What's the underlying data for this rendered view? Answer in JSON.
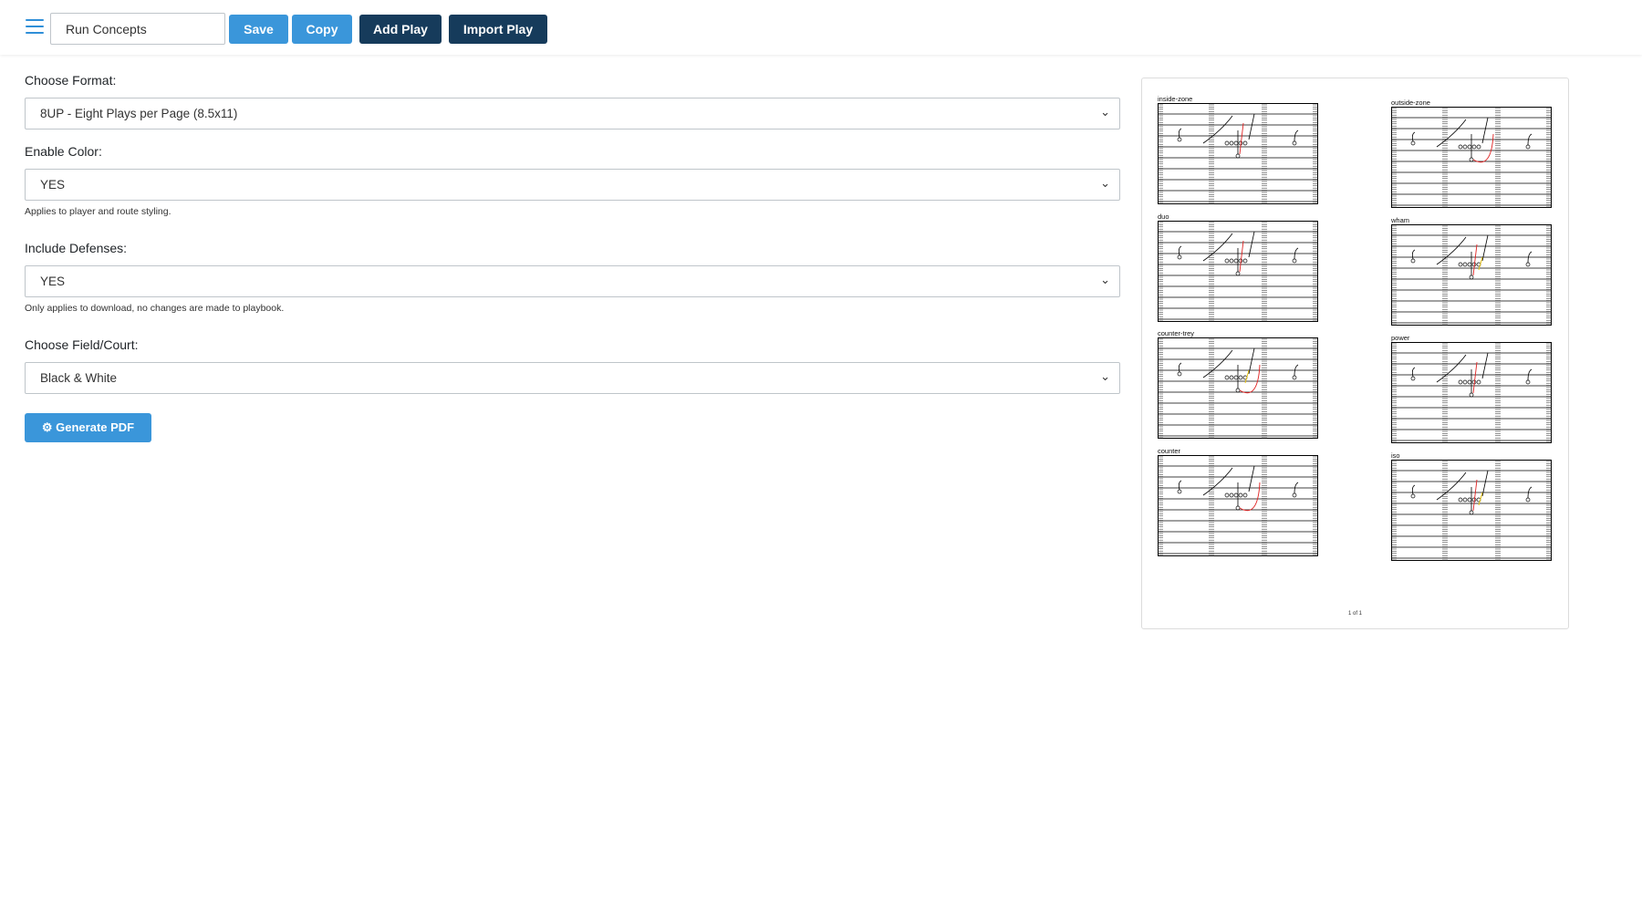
{
  "toolbar": {
    "menu_icon": "hamburger-menu-icon",
    "playbook_name": "Run Concepts",
    "save_label": "Save",
    "copy_label": "Copy",
    "add_play_label": "Add Play",
    "import_play_label": "Import Play",
    "accent_color": "#3a96da",
    "dark_color": "#163b5b"
  },
  "form": {
    "format": {
      "label": "Choose Format:",
      "value": "8UP - Eight Plays per Page (8.5x11)"
    },
    "color": {
      "label": "Enable Color:",
      "value": "YES",
      "help": "Applies to player and route styling."
    },
    "defenses": {
      "label": "Include Defenses:",
      "value": "YES",
      "help": "Only applies to download, no changes are made to playbook."
    },
    "field": {
      "label": "Choose Field/Court:",
      "value": "Black & White"
    },
    "generate_label": "Generate PDF",
    "generate_icon": "gear-icon"
  },
  "preview": {
    "plays": [
      {
        "name": "inside-zone"
      },
      {
        "name": "outside-zone"
      },
      {
        "name": "duo"
      },
      {
        "name": "wham"
      },
      {
        "name": "counter-trey"
      },
      {
        "name": "power"
      },
      {
        "name": "counter"
      },
      {
        "name": "iso"
      }
    ],
    "page_indicator": "1 of 1"
  }
}
